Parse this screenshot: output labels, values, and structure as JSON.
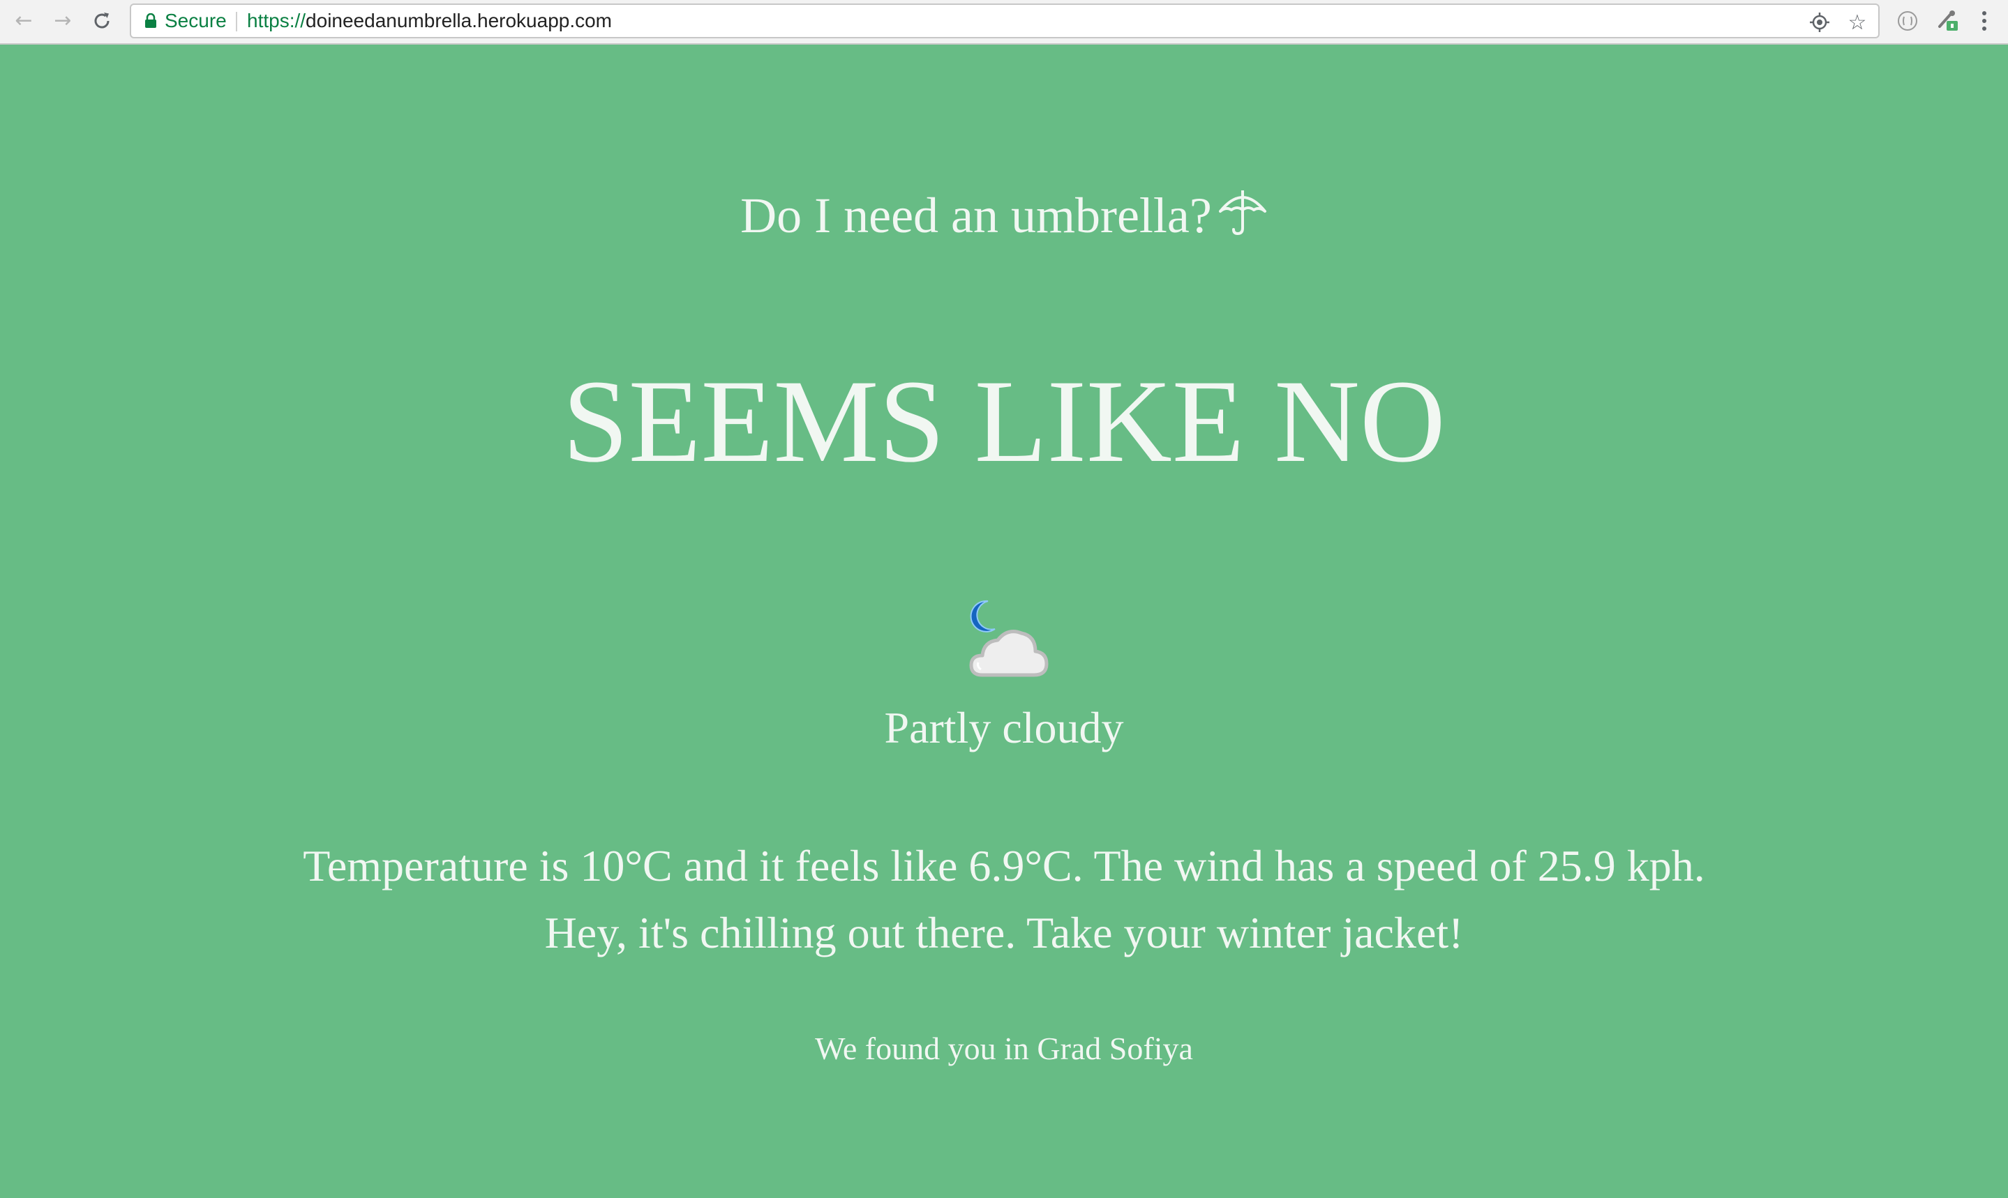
{
  "browser": {
    "secure_label": "Secure",
    "url_scheme": "https://",
    "url_host": "doineedanumbrella.herokuapp.com",
    "icons": [
      "back-arrow-icon",
      "forward-arrow-icon",
      "reload-icon",
      "lock-icon",
      "location-icon",
      "star-icon",
      "extension-icon",
      "extension-icon",
      "menu-icon"
    ]
  },
  "page": {
    "question": "Do I need an umbrella?",
    "answer": "SEEMS LIKE NO",
    "condition": "Partly cloudy",
    "details_line1": "Temperature is 10°C and it feels like 6.9°C. The wind has a speed of 25.9 kph.",
    "details_line2": "Hey, it's chilling out there. Take your winter jacket!",
    "location": "We found you in Grad Sofiya",
    "icons": [
      "umbrella-icon",
      "partly-cloudy-night-icon"
    ]
  },
  "colors": {
    "background": "#67bc85",
    "text": "#f1f7f2",
    "secure_green": "#0b8043"
  }
}
